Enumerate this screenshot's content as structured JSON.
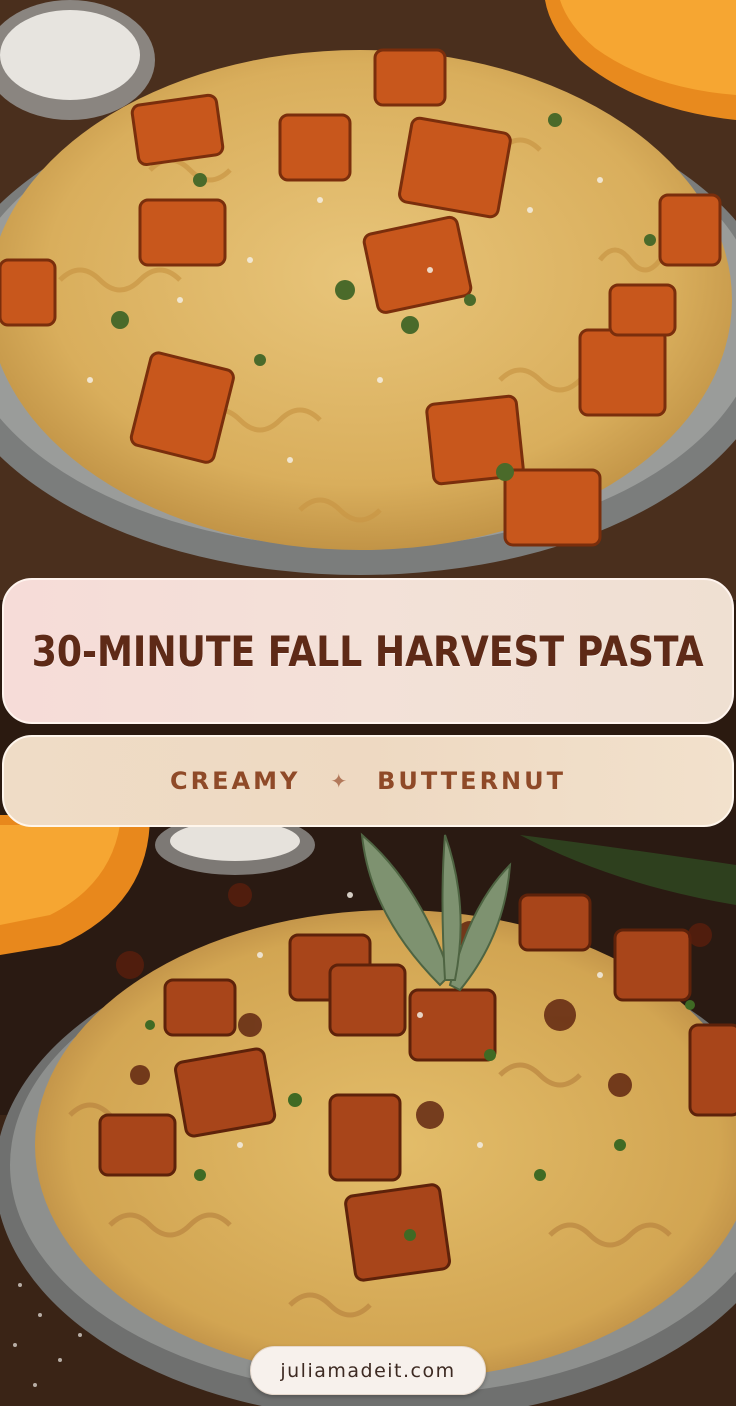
{
  "title": "30-MINUTE FALL HARVEST PASTA",
  "subtitle": {
    "left": "CREAMY",
    "separator": "✦",
    "right": "BUTTERNUT"
  },
  "website": "juliamadeit.com",
  "colors": {
    "title_text": "#5e2a17",
    "subtitle_text": "#8f4a28",
    "banner_pink": "#f6dcd8",
    "banner_beige": "#efdcc6"
  }
}
